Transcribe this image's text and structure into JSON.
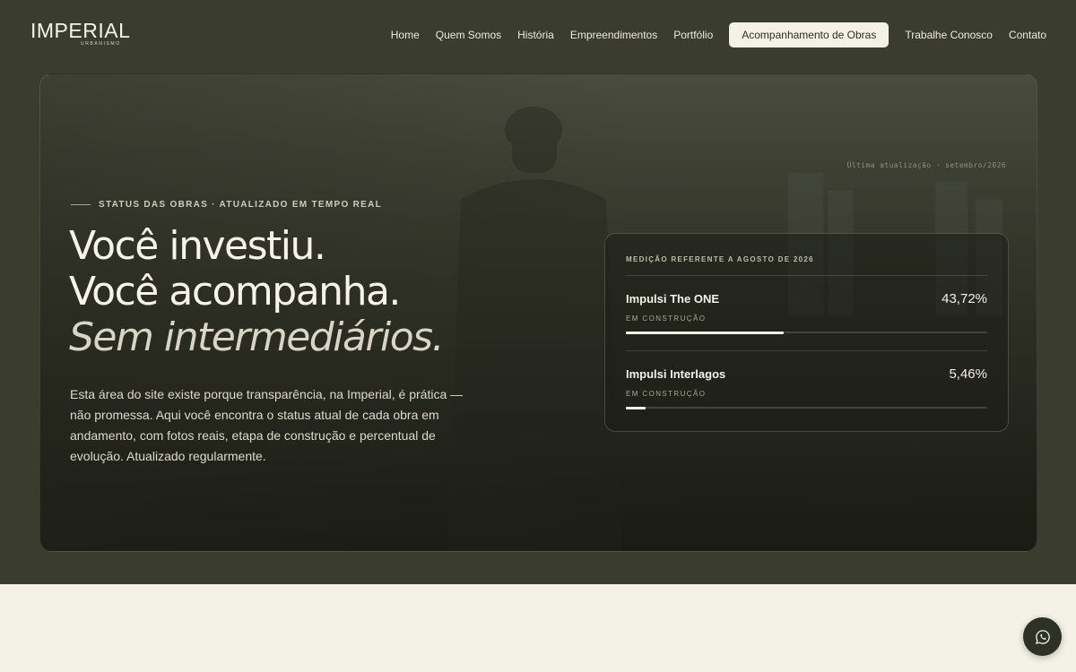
{
  "header": {
    "logo": {
      "main": "IMPERIAL",
      "sub": "URBANISMO"
    },
    "nav": [
      {
        "label": "Home"
      },
      {
        "label": "Quem Somos"
      },
      {
        "label": "História"
      },
      {
        "label": "Empreendimentos"
      },
      {
        "label": "Portfólio"
      },
      {
        "label": "Acompanhamento de Obras",
        "active": true
      },
      {
        "label": "Trabalhe Conosco"
      },
      {
        "label": "Contato"
      }
    ]
  },
  "hero": {
    "update_stamp": "Última atualização · setembro/2026",
    "eyebrow": "STATUS DAS OBRAS · ATUALIZADO EM TEMPO REAL",
    "headline": {
      "line1": "Você investiu.",
      "line2": "Você acompanha.",
      "line3": "Sem intermediários."
    },
    "intro": "Esta área do site existe porque transparência, na Imperial, é prática — não promessa. Aqui você encontra o status atual de cada obra em andamento, com fotos reais, etapa de construção e percentual de evolução. Atualizado regularmente."
  },
  "progress_card": {
    "label": "MEDIÇÃO REFERENTE A AGOSTO DE 2026",
    "projects": [
      {
        "name": "Impulsi The ONE",
        "percent_text": "43,72%",
        "percent": 43.72,
        "status": "EM CONSTRUÇÃO"
      },
      {
        "name": "Impulsi Interlagos",
        "percent_text": "5,46%",
        "percent": 5.46,
        "status": "EM CONSTRUÇÃO"
      }
    ]
  },
  "floating": {
    "icon": "whatsapp-icon"
  },
  "colors": {
    "background": "#3a3d2d",
    "cream": "#f4f1e6",
    "accent_light": "#f4f2e8"
  }
}
